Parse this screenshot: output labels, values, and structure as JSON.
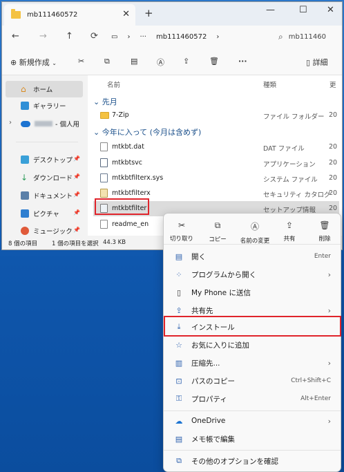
{
  "window": {
    "tab_title": "mb111460572",
    "new_tab": "+",
    "controls": {
      "minimize": "—",
      "maximize": "☐",
      "close": "✕"
    }
  },
  "addressbar": {
    "back": "←",
    "forward": "→",
    "up": "↑",
    "ellipsis": "···",
    "path": "mb111460572",
    "search_placeholder": "mb111460"
  },
  "toolbar": {
    "new_label": "新規作成",
    "more": "···",
    "details_label": "詳細"
  },
  "sidebar": {
    "items": [
      {
        "label": "ホーム",
        "icon": "home-icon",
        "selected": true
      },
      {
        "label": "ギャラリー",
        "icon": "gallery-icon"
      },
      {
        "label": "- 個人用",
        "icon": "onedrive-icon"
      },
      {
        "label": "デスクトップ",
        "icon": "desktop-icon"
      },
      {
        "label": "ダウンロード",
        "icon": "download-icon"
      },
      {
        "label": "ドキュメント",
        "icon": "document-icon"
      },
      {
        "label": "ピクチャ",
        "icon": "picture-icon"
      },
      {
        "label": "ミュージック",
        "icon": "music-icon"
      }
    ]
  },
  "content": {
    "columns": {
      "name": "名前",
      "type": "種類",
      "date": "更"
    },
    "groups": [
      {
        "label": "先月"
      },
      {
        "label": "今年に入って (今月は含めず)"
      }
    ],
    "files": [
      {
        "name": "7-Zip",
        "type": "ファイル フォルダー",
        "date": "20",
        "icon": "folder-icon"
      },
      {
        "name": "mtkbt.dat",
        "type": "DAT ファイル",
        "date": "20",
        "icon": "file-icon"
      },
      {
        "name": "mtkbtsvc",
        "type": "アプリケーション",
        "date": "20",
        "icon": "app-icon"
      },
      {
        "name": "mtkbtfilterx.sys",
        "type": "システム ファイル",
        "date": "20",
        "icon": "sys-file-icon"
      },
      {
        "name": "mtkbtfilterx",
        "type": "セキュリティ カタログ",
        "date": "20",
        "icon": "catalog-icon"
      },
      {
        "name": "mtkbtfilter",
        "type": "セットアップ情報",
        "date": "20",
        "icon": "inf-file-icon",
        "selected": true
      },
      {
        "name": "readme_en",
        "type": "",
        "date": "",
        "icon": "file-icon"
      }
    ]
  },
  "statusbar": {
    "count": "8 個の項目",
    "selection": "1 個の項目を選択",
    "size": "44.3 KB"
  },
  "context_menu": {
    "quick_actions": [
      {
        "label": "切り取り",
        "icon": "cut-icon"
      },
      {
        "label": "コピー",
        "icon": "copy-icon"
      },
      {
        "label": "名前の変更",
        "icon": "rename-icon"
      },
      {
        "label": "共有",
        "icon": "share-icon"
      },
      {
        "label": "削除",
        "icon": "delete-icon"
      }
    ],
    "items": [
      {
        "label": "開く",
        "accel": "Enter",
        "icon": "open-icon"
      },
      {
        "label": "プログラムから開く",
        "submenu": true,
        "icon": "open-with-icon"
      },
      {
        "label": "My Phone に送信",
        "icon": "phone-icon"
      },
      {
        "label": "共有先",
        "submenu": true,
        "icon": "share-to-icon"
      },
      {
        "label": "インストール",
        "icon": "install-icon",
        "highlighted": true
      },
      {
        "label": "お気に入りに追加",
        "icon": "star-icon"
      },
      {
        "label": "圧縮先...",
        "submenu": true,
        "icon": "compress-icon"
      },
      {
        "label": "パスのコピー",
        "accel": "Ctrl+Shift+C",
        "icon": "copy-path-icon"
      },
      {
        "label": "プロパティ",
        "accel": "Alt+Enter",
        "icon": "properties-icon"
      },
      {
        "label": "OneDrive",
        "submenu": true,
        "icon": "onedrive-icon"
      },
      {
        "label": "メモ帳で編集",
        "icon": "notepad-icon"
      },
      {
        "label": "その他のオプションを確認",
        "icon": "more-options-icon"
      }
    ]
  },
  "colors": {
    "highlight": "#e0242b",
    "accent": "#2b5fad"
  }
}
